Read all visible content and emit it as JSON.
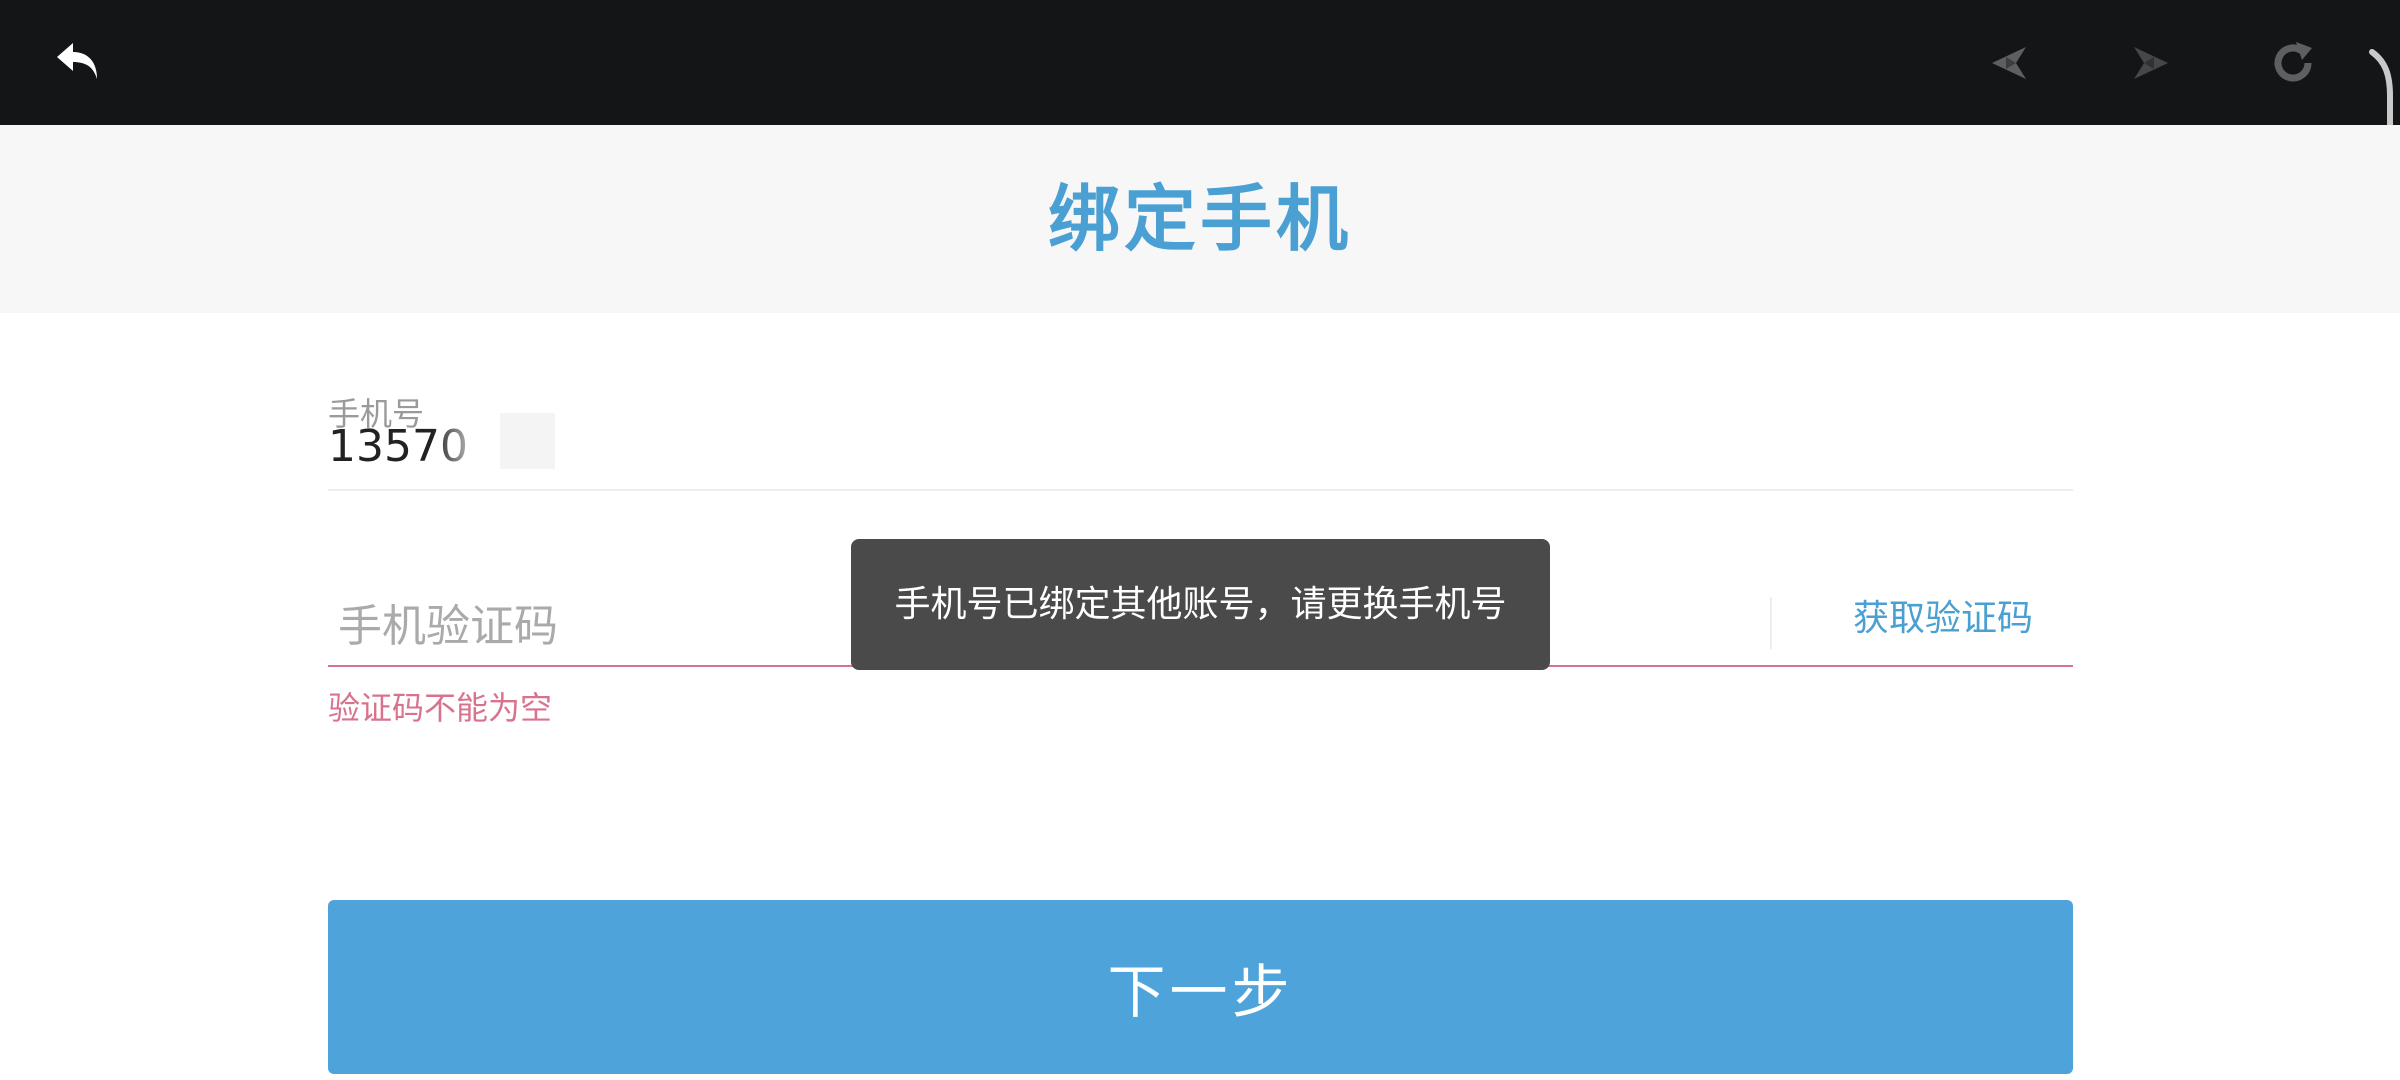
{
  "toolbar": {
    "back_icon": "back-arrow-icon",
    "prev_icon": "prev-arrow-icon",
    "next_icon": "next-arrow-icon",
    "refresh_icon": "refresh-icon"
  },
  "header": {
    "title": "绑定手机"
  },
  "form": {
    "phone_label": "手机号",
    "phone_value": "13570",
    "code_placeholder": "手机验证码",
    "code_value": "",
    "get_code_label": "获取验证码",
    "error_message": "验证码不能为空",
    "next_label": "下一步"
  },
  "toast": {
    "message": "手机号已绑定其他账号，请更换手机号"
  },
  "colors": {
    "topbar": "#141517",
    "accent": "#4aa0d3",
    "button": "#4ea3db",
    "error": "#d9738d",
    "toast_bg": "#4a4a4a"
  }
}
